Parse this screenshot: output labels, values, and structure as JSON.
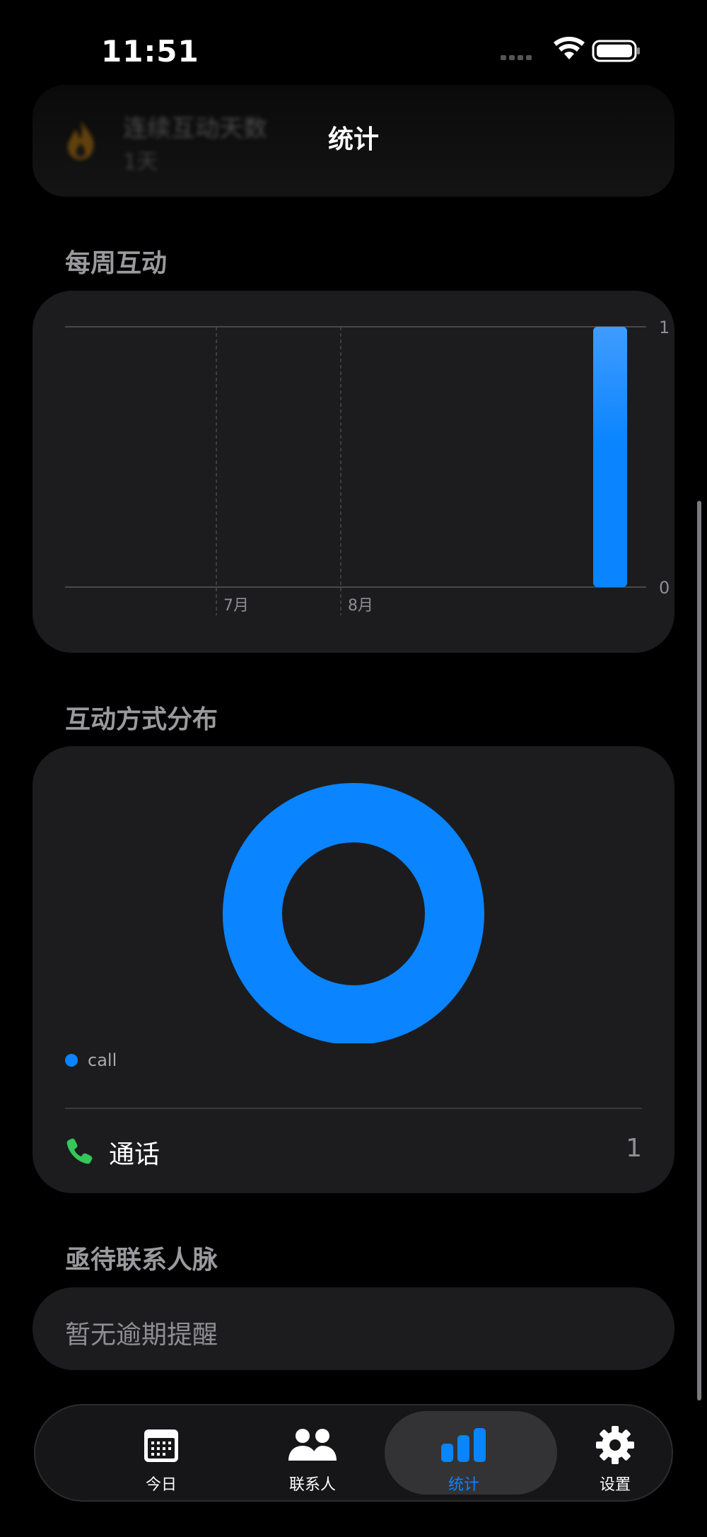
{
  "status": {
    "time": "11:51"
  },
  "nav": {
    "title": "统计"
  },
  "streak": {
    "title": "连续互动天数",
    "value": "1天"
  },
  "weekly": {
    "section_title": "每周互动",
    "chart_data": {
      "type": "bar",
      "categories": [
        "",
        "7月",
        "8月",
        ""
      ],
      "values": [
        0,
        0,
        0,
        1
      ],
      "ylim": [
        0,
        1
      ],
      "y_ticks": [
        "1",
        "0"
      ],
      "x_tick_labels": [
        "7月",
        "8月"
      ],
      "grid": true,
      "bar_color": "#0a84ff"
    }
  },
  "distribution": {
    "section_title": "互动方式分布",
    "chart_data": {
      "type": "pie",
      "labels": [
        "call"
      ],
      "values": [
        1
      ],
      "colors": [
        "#0a84ff"
      ]
    },
    "legend": [
      {
        "label": "call",
        "color": "#0a84ff"
      }
    ],
    "rows": [
      {
        "icon": "phone-icon",
        "label": "通话",
        "count": "1"
      }
    ]
  },
  "overdue": {
    "section_title": "亟待联系人脉",
    "empty_text": "暂无逾期提醒"
  },
  "tabbar": {
    "tabs": [
      {
        "label": "今日",
        "icon": "calendar-icon"
      },
      {
        "label": "联系人",
        "icon": "people-icon"
      },
      {
        "label": "统计",
        "icon": "chart-icon",
        "active": true
      },
      {
        "label": "设置",
        "icon": "gear-icon"
      }
    ]
  },
  "colors": {
    "accent": "#0a84ff",
    "card": "#1c1c1e",
    "call": "#34c759"
  }
}
